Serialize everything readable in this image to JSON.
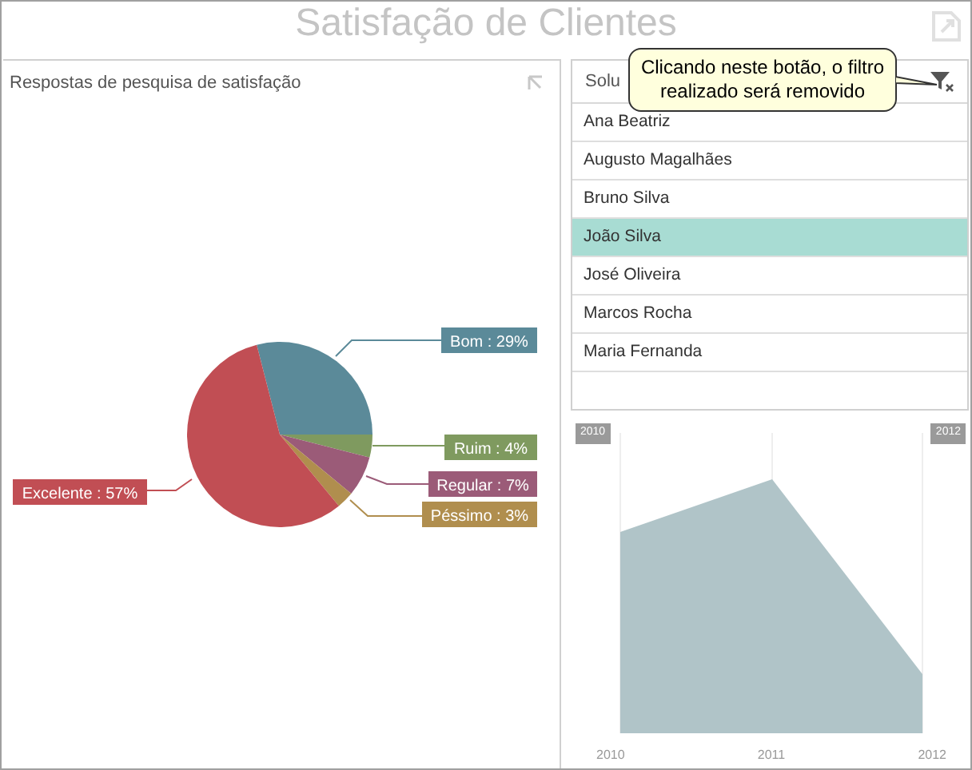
{
  "title": "Satisfação de Clientes",
  "survey_panel": {
    "title": "Respostas de pesquisa de satisfação",
    "chart_data": {
      "type": "pie",
      "categories": [
        "Bom",
        "Ruim",
        "Regular",
        "Péssimo",
        "Excelente"
      ],
      "values": [
        29,
        4,
        7,
        3,
        57
      ],
      "data_labels": true,
      "value_labels": [
        "29%",
        "4%",
        "7%",
        "3%",
        "57%"
      ]
    }
  },
  "solutions_panel": {
    "title": "Solu",
    "items": [
      {
        "label": "Ana Beatriz",
        "selected": false
      },
      {
        "label": "Augusto Magalhães",
        "selected": false
      },
      {
        "label": "Bruno Silva",
        "selected": false
      },
      {
        "label": "João Silva",
        "selected": true
      },
      {
        "label": "José Oliveira",
        "selected": false
      },
      {
        "label": "Marcos Rocha",
        "selected": false
      },
      {
        "label": "Maria Fernanda",
        "selected": false
      }
    ]
  },
  "tooltip": "Clicando neste botão, o filtro realizado será removido",
  "range_panel": {
    "start_flag": "2010",
    "end_flag": "2012",
    "axis_labels": [
      "2010",
      "2011",
      "2012"
    ]
  }
}
